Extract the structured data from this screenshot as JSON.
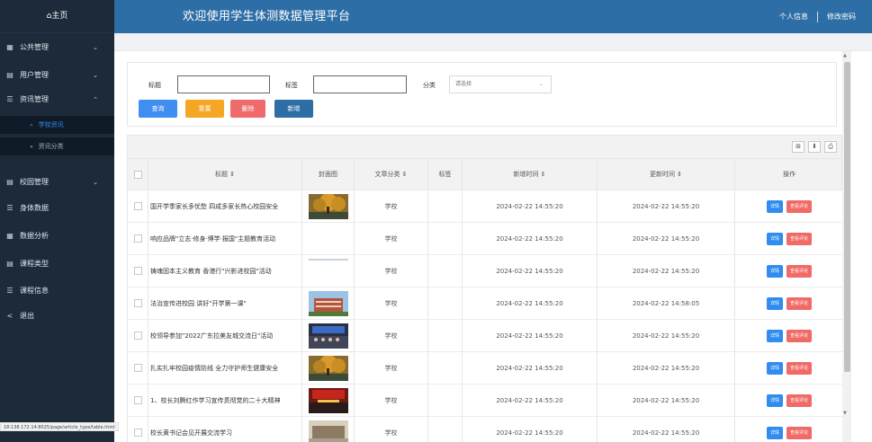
{
  "sidebar": {
    "home": "⌂主页",
    "items": [
      {
        "icon": "grid-icon",
        "label": "公共管理",
        "chev": "⌄"
      },
      {
        "icon": "list-icon",
        "label": "用户管理",
        "chev": "⌄"
      },
      {
        "icon": "menu-icon",
        "label": "资讯管理",
        "chev": "⌃"
      },
      {
        "icon": "list-icon",
        "label": "校园管理",
        "chev": "⌄"
      },
      {
        "icon": "menu-icon",
        "label": "身体数据",
        "chev": ""
      },
      {
        "icon": "grid-icon",
        "label": "数据分析",
        "chev": ""
      },
      {
        "icon": "list-icon",
        "label": "课程类型",
        "chev": ""
      },
      {
        "icon": "menu-icon",
        "label": "课程信息",
        "chev": ""
      },
      {
        "icon": "logout-icon",
        "label": "退出",
        "chev": ""
      }
    ],
    "subitems": [
      {
        "label": "学校资讯"
      },
      {
        "label": "资讯分类"
      }
    ]
  },
  "header": {
    "title": "欢迎使用学生体测数据管理平台",
    "personal": "个人信息",
    "change_password": "修改密码"
  },
  "filter": {
    "title_label": "标题",
    "tag_label": "标签",
    "category_label": "分类",
    "category_placeholder": "请选择",
    "query": "查询",
    "reset": "重置",
    "delete": "删除",
    "add": "新增"
  },
  "colors": {
    "query": "#3f8ef2",
    "reset": "#f5a623",
    "delete": "#ef6b6b",
    "add": "#2d6ea6",
    "detail": "#2f8cf0",
    "comment": "#f06a66"
  },
  "table": {
    "headers": {
      "title": "标题 ⇕",
      "cover": "封面图",
      "category": "文章分类 ⇕",
      "tag": "标签",
      "created": "新增时间 ⇕",
      "updated": "更新时间 ⇕",
      "ops": "操作"
    },
    "rows": [
      {
        "title": "国开学季家长多忧愁 四成多家长热心校园安全",
        "cover": "tree",
        "category": "学校",
        "created": "2024-02-22 14:55:20",
        "updated": "2024-02-22 14:55:20"
      },
      {
        "title": "响应品牌\"立志·修身·博学·报国\"主题教育活动",
        "cover": "",
        "category": "学校",
        "created": "2024-02-22 14:55:20",
        "updated": "2024-02-22 14:55:20"
      },
      {
        "title": "铸魂固本主义教育 香港行\"兴影进校园\"活动",
        "cover": "line",
        "category": "学校",
        "created": "2024-02-22 14:55:20",
        "updated": "2024-02-22 14:55:20"
      },
      {
        "title": "法治宣传进校园 讲好\"开学第一课\"",
        "cover": "building",
        "category": "学校",
        "created": "2024-02-22 14:55:20",
        "updated": "2024-02-22 14:58:05"
      },
      {
        "title": "校领导参加\"2022广东拉美友城交流日\"活动",
        "cover": "meeting",
        "category": "学校",
        "created": "2024-02-22 14:55:20",
        "updated": "2024-02-22 14:55:20"
      },
      {
        "title": "扎实扎牢校园疫情防线 全力守护师生健康安全",
        "cover": "tree",
        "category": "学校",
        "created": "2024-02-22 14:55:20",
        "updated": "2024-02-22 14:55:20"
      },
      {
        "title": "1、校长刘腾红作学习宣传贯彻党的二十大精神",
        "cover": "stage",
        "category": "学校",
        "created": "2024-02-22 14:55:20",
        "updated": "2024-02-22 14:55:20"
      },
      {
        "title": "校长黄书记会见开展交流学习",
        "cover": "hall",
        "category": "学校",
        "created": "2024-02-22 14:55:20",
        "updated": "2024-02-22 14:55:20"
      }
    ],
    "detail_label": "详情",
    "comment_label": "查看评论"
  },
  "statusbar": {
    "url": "18:138.172.14:8025/page/article_type/table.html"
  }
}
